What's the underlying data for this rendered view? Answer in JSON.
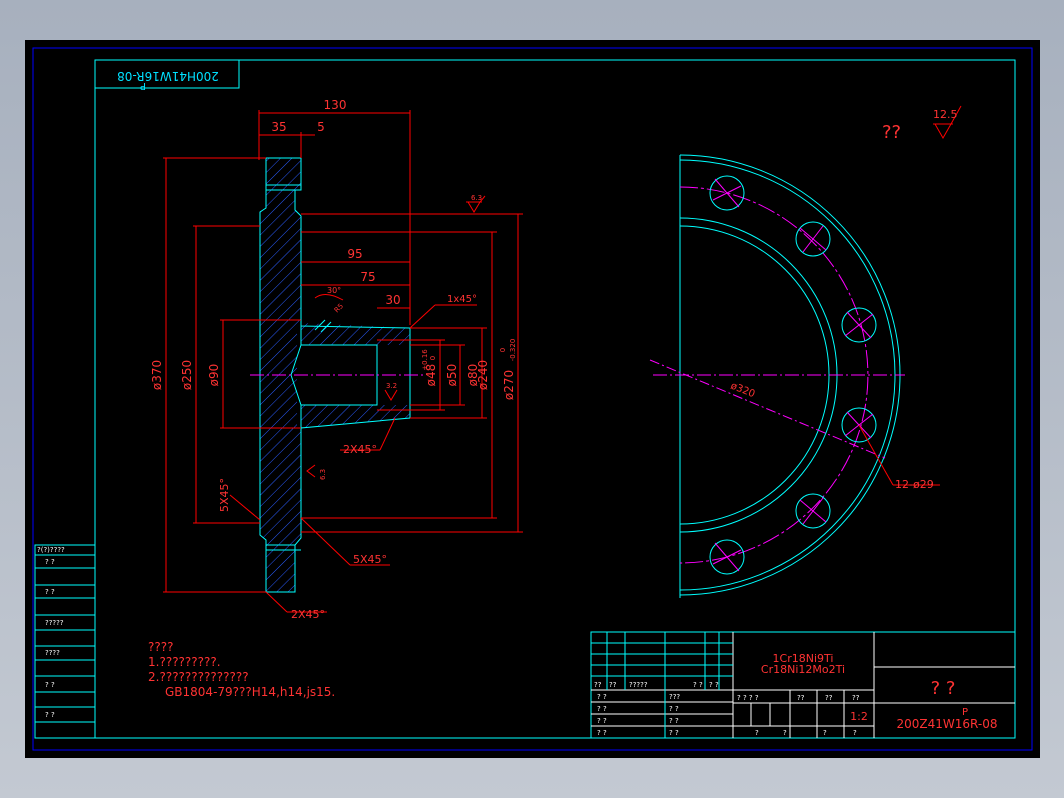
{
  "stamp": "200H41W16R-08",
  "stamp_sub": "P",
  "dims": {
    "d130": "130",
    "d35": "35",
    "d5": "5",
    "d95": "95",
    "d75": "75",
    "d30": "30",
    "chamfer_top": "1x45°",
    "d370": "ø370",
    "d250": "ø250",
    "d90": "ø90",
    "d48": "ø48",
    "d48_tol_up": "+0.16",
    "d48_tol_lo": "0",
    "d50": "ø50",
    "d80": "ø80",
    "d240": "ø240",
    "d270": "ø270",
    "d270_tol_up": "0",
    "d270_tol_lo": "-0.320",
    "chamfer_mid": "2X45°",
    "chamfer_5x45_left": "5X45°",
    "chamfer_5x45": "5X45°",
    "chamfer_bottom": "2X45°",
    "angle": "30°",
    "r_small": "R5",
    "rough_63a": "6.3",
    "rough_63b": "6.3",
    "rough_32": "3.2",
    "pcd": "ø320",
    "holes": "12-ø29"
  },
  "roughness": {
    "marks": "??",
    "value": "12.5"
  },
  "notes": {
    "heading": "????",
    "line1": "1.?????????.",
    "line2": "2.??????????????",
    "line3": "GB1804-79???H14,h14,js15."
  },
  "left_table": {
    "header": "?(?)????",
    "rows": [
      "?   ?",
      "?   ?",
      "?????",
      "????",
      "?   ?",
      "?   ?"
    ]
  },
  "title_block": {
    "material_1": "1Cr18Ni9Ti",
    "material_2": "Cr18Ni12Mo2Ti",
    "name": "?   ?",
    "code_p": "P",
    "code": "200Z41W16R-08",
    "scale": "1:2",
    "hdr_row": [
      "??",
      "??",
      "?????",
      "? ?",
      "? ?"
    ],
    "row_labels": [
      "? ?",
      "? ?",
      "? ?",
      "? ?"
    ],
    "row_labels_mid": [
      "???",
      "? ?",
      "? ?",
      "? ?"
    ],
    "hdr_right": [
      "? ? ? ?",
      "??",
      "??",
      "??"
    ],
    "foot_right": [
      "?",
      "?",
      "?",
      "?"
    ]
  }
}
